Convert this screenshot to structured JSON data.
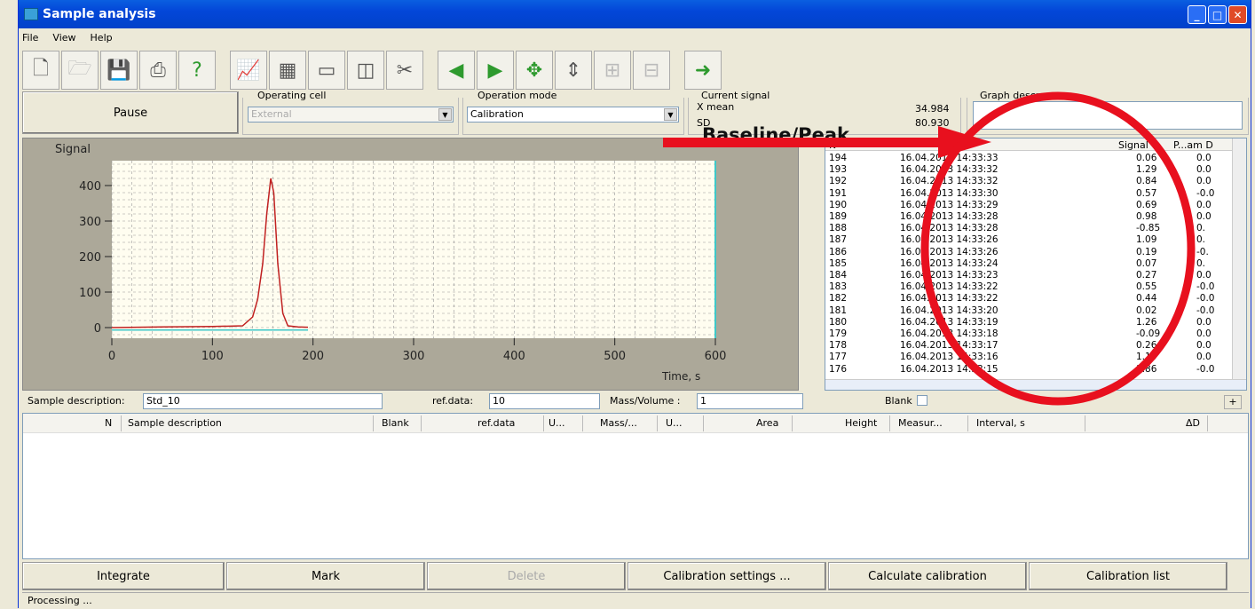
{
  "title": "Sample analysis",
  "menu": [
    "File",
    "View",
    "Help"
  ],
  "pause_label": "Pause",
  "operating_cell": {
    "label": "Operating cell",
    "value": "External"
  },
  "operation_mode": {
    "label": "Operation mode",
    "value": "Calibration"
  },
  "current_signal": {
    "label": "Current signal",
    "xmean_label": "X mean",
    "xmean_value": "34.984",
    "sd_label": "SD",
    "sd_value": "80.930"
  },
  "graph_description": {
    "label": "Graph descr..."
  },
  "annotation": "Baseline/Peak",
  "chart_data": {
    "type": "line",
    "title": "",
    "ylabel": "Signal",
    "xlabel": "Time, s",
    "xlim": [
      0,
      600
    ],
    "ylim": [
      -30,
      470
    ],
    "xticks": [
      "0",
      "100",
      "200",
      "300",
      "400",
      "500",
      "600"
    ],
    "yticks": [
      "0",
      "100",
      "200",
      "300",
      "400"
    ],
    "grid": true,
    "series": [
      {
        "x": [
          0,
          50,
          100,
          130,
          140,
          145,
          150,
          154,
          158,
          161,
          165,
          170,
          175,
          185,
          195
        ],
        "y": [
          0,
          2,
          3,
          5,
          30,
          80,
          180,
          320,
          420,
          380,
          180,
          40,
          5,
          2,
          1
        ],
        "color": "#c02020"
      }
    ],
    "baseline": {
      "x": [
        0,
        195
      ],
      "y": [
        -7,
        -7
      ],
      "color": "#3ec8c8"
    }
  },
  "grid": {
    "columns": [
      "N",
      "",
      "Signal",
      "P...am D"
    ],
    "rows": [
      [
        "194",
        "16.04.2013 14:33:33",
        "0.06",
        "0.0"
      ],
      [
        "193",
        "16.04.2013 14:33:32",
        "1.29",
        "0.0"
      ],
      [
        "192",
        "16.04.2013 14:33:32",
        "0.84",
        "0.0"
      ],
      [
        "191",
        "16.04.2013 14:33:30",
        "0.57",
        "-0.0"
      ],
      [
        "190",
        "16.04.2013 14:33:29",
        "0.69",
        "0.0"
      ],
      [
        "189",
        "16.04.2013 14:33:28",
        "0.98",
        "0.0"
      ],
      [
        "188",
        "16.04.2013 14:33:28",
        "-0.85",
        "0."
      ],
      [
        "187",
        "16.04.2013 14:33:26",
        "1.09",
        "0."
      ],
      [
        "186",
        "16.04.2013 14:33:26",
        "0.19",
        "-0."
      ],
      [
        "185",
        "16.04.2013 14:33:24",
        "0.07",
        "0."
      ],
      [
        "184",
        "16.04.2013 14:33:23",
        "0.27",
        "0.0"
      ],
      [
        "183",
        "16.04.2013 14:33:22",
        "0.55",
        "-0.0"
      ],
      [
        "182",
        "16.04.2013 14:33:22",
        "0.44",
        "-0.0"
      ],
      [
        "181",
        "16.04.2013 14:33:20",
        "0.02",
        "-0.0"
      ],
      [
        "180",
        "16.04.2013 14:33:19",
        "1.26",
        "0.0"
      ],
      [
        "179",
        "16.04.2013 14:33:18",
        "-0.09",
        "0.0"
      ],
      [
        "178",
        "16.04.2013 14:33:17",
        "0.26",
        "0.0"
      ],
      [
        "177",
        "16.04.2013 14:33:16",
        "1.15",
        "0.0"
      ],
      [
        "176",
        "16.04.2013 14:33:15",
        "1.86",
        "-0.0"
      ]
    ]
  },
  "form": {
    "sample_description_label": "Sample description:",
    "sample_description_value": "Std_10",
    "ref_data_label": "ref.data:",
    "ref_data_value": "10",
    "mass_volume_label": "Mass/Volume :",
    "mass_volume_value": "1",
    "blank_label": "Blank",
    "plus": "+"
  },
  "list_headers": [
    "N",
    "Sample description",
    "Blank",
    "ref.data",
    "U...",
    "Mass/...",
    "U...",
    "Area",
    "Height",
    "Measur...",
    "Interval, s",
    "ΔD"
  ],
  "buttons": {
    "integrate": "Integrate",
    "mark": "Mark",
    "delete": "Delete",
    "calibration_settings": "Calibration settings ...",
    "calculate_calibration": "Calculate calibration",
    "calibration_list": "Calibration list"
  },
  "status": "Processing ..."
}
